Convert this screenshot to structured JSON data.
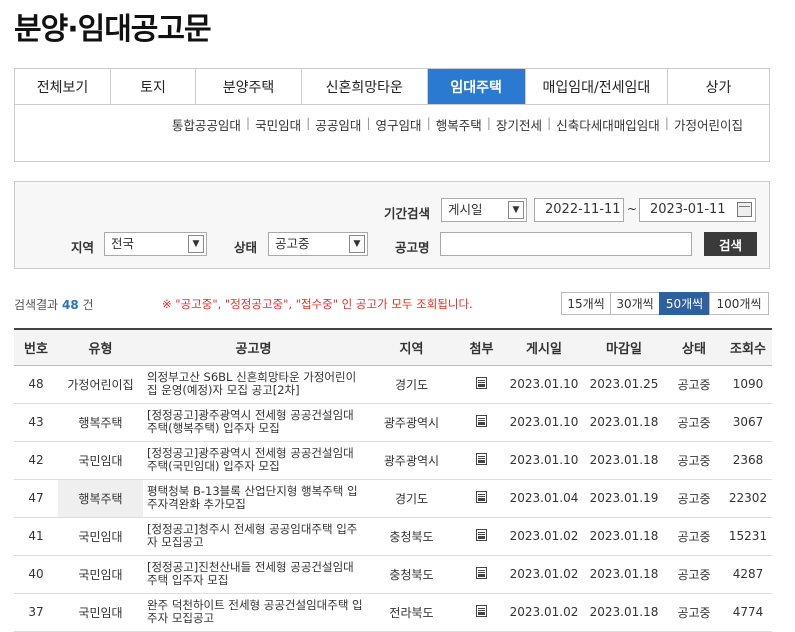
{
  "page_title": "분양·임대공고문",
  "topbar": [
    "",
    ""
  ],
  "tabs": [
    {
      "label": "전체보기",
      "active": false
    },
    {
      "label": "토지",
      "active": false
    },
    {
      "label": "분양주택",
      "active": false
    },
    {
      "label": "신혼희망타운",
      "active": false
    },
    {
      "label": "임대주택",
      "active": true
    },
    {
      "label": "매입임대/전세임대",
      "active": false
    },
    {
      "label": "상가",
      "active": false
    }
  ],
  "subnav": [
    "통합공공임대",
    "국민임대",
    "공공임대",
    "영구임대",
    "행복주택",
    "장기전세",
    "신축다세대매입임대",
    "가정어린이집"
  ],
  "search": {
    "period_label": "기간검색",
    "period_select": "게시일",
    "date_from": "2022-11-11",
    "date_sep": "~",
    "date_to": "2023-01-11",
    "region_label": "지역",
    "region_select": "전국",
    "status_label": "상태",
    "status_select": "공고중",
    "name_label": "공고명",
    "name_value": "",
    "button": "검색"
  },
  "result": {
    "prefix": "검색결과",
    "count": "48",
    "suffix": "건"
  },
  "notice": "※ \"공고중\", \"정정공고중\", \"접수중\" 인 공고가 모두 조회됩니다.",
  "page_sizes": [
    {
      "label": "15개씩",
      "active": false
    },
    {
      "label": "30개씩",
      "active": false
    },
    {
      "label": "50개씩",
      "active": true
    },
    {
      "label": "100개씩",
      "active": false
    }
  ],
  "table": {
    "headers": [
      "번호",
      "유형",
      "공고명",
      "지역",
      "첨부",
      "게시일",
      "마감일",
      "상태",
      "조회수"
    ],
    "rows": [
      {
        "no": "48",
        "type": "가정어린이집",
        "title": "의정부고산 S6BL 신혼희망타운 가정어린이집 운영(예정)자 모집 공고[2차]",
        "region": "경기도",
        "attach": "file-icon",
        "posted": "2023.01.10",
        "deadline": "2023.01.25",
        "status": "공고중",
        "views": "1090"
      },
      {
        "no": "43",
        "type": "행복주택",
        "title": "[정정공고]광주광역시 전세형 공공건설임대주택(행복주택) 입주자 모집",
        "region": "광주광역시",
        "attach": "file-icon",
        "posted": "2023.01.10",
        "deadline": "2023.01.18",
        "status": "공고중",
        "views": "3067"
      },
      {
        "no": "42",
        "type": "국민임대",
        "title": "[정정공고]광주광역시 전세형 공공건설임대주택(국민임대) 입주자 모집",
        "region": "광주광역시",
        "attach": "file-icon",
        "posted": "2023.01.10",
        "deadline": "2023.01.18",
        "status": "공고중",
        "views": "2368"
      },
      {
        "no": "47",
        "type": "행복주택",
        "title": "평택청북 B-13블록 산업단지형 행복주택 입주자격완화 추가모집",
        "region": "경기도",
        "attach": "file-icon",
        "posted": "2023.01.04",
        "deadline": "2023.01.19",
        "status": "공고중",
        "views": "22302"
      },
      {
        "no": "41",
        "type": "국민임대",
        "title": "[정정공고]청주시 전세형 공공임대주택 입주자 모집공고",
        "region": "충청북도",
        "attach": "file-icon",
        "posted": "2023.01.02",
        "deadline": "2023.01.18",
        "status": "공고중",
        "views": "15231"
      },
      {
        "no": "40",
        "type": "국민임대",
        "title": "[정정공고]진천산내들 전세형 공공건설임대주택 입주자 모집",
        "region": "충청북도",
        "attach": "file-icon",
        "posted": "2023.01.02",
        "deadline": "2023.01.18",
        "status": "공고중",
        "views": "4287"
      },
      {
        "no": "37",
        "type": "국민임대",
        "title": "완주 덕천하이트 전세형 공공건설임대주택 입주자 모집공고",
        "region": "전라북도",
        "attach": "file-icon",
        "posted": "2023.01.02",
        "deadline": "2023.01.18",
        "status": "공고중",
        "views": "4774"
      }
    ]
  },
  "colors": {
    "accent": "#2a7ad2",
    "pager_active": "#2e5f9e",
    "notice": "#e0302c",
    "count": "#2a6fc0"
  }
}
